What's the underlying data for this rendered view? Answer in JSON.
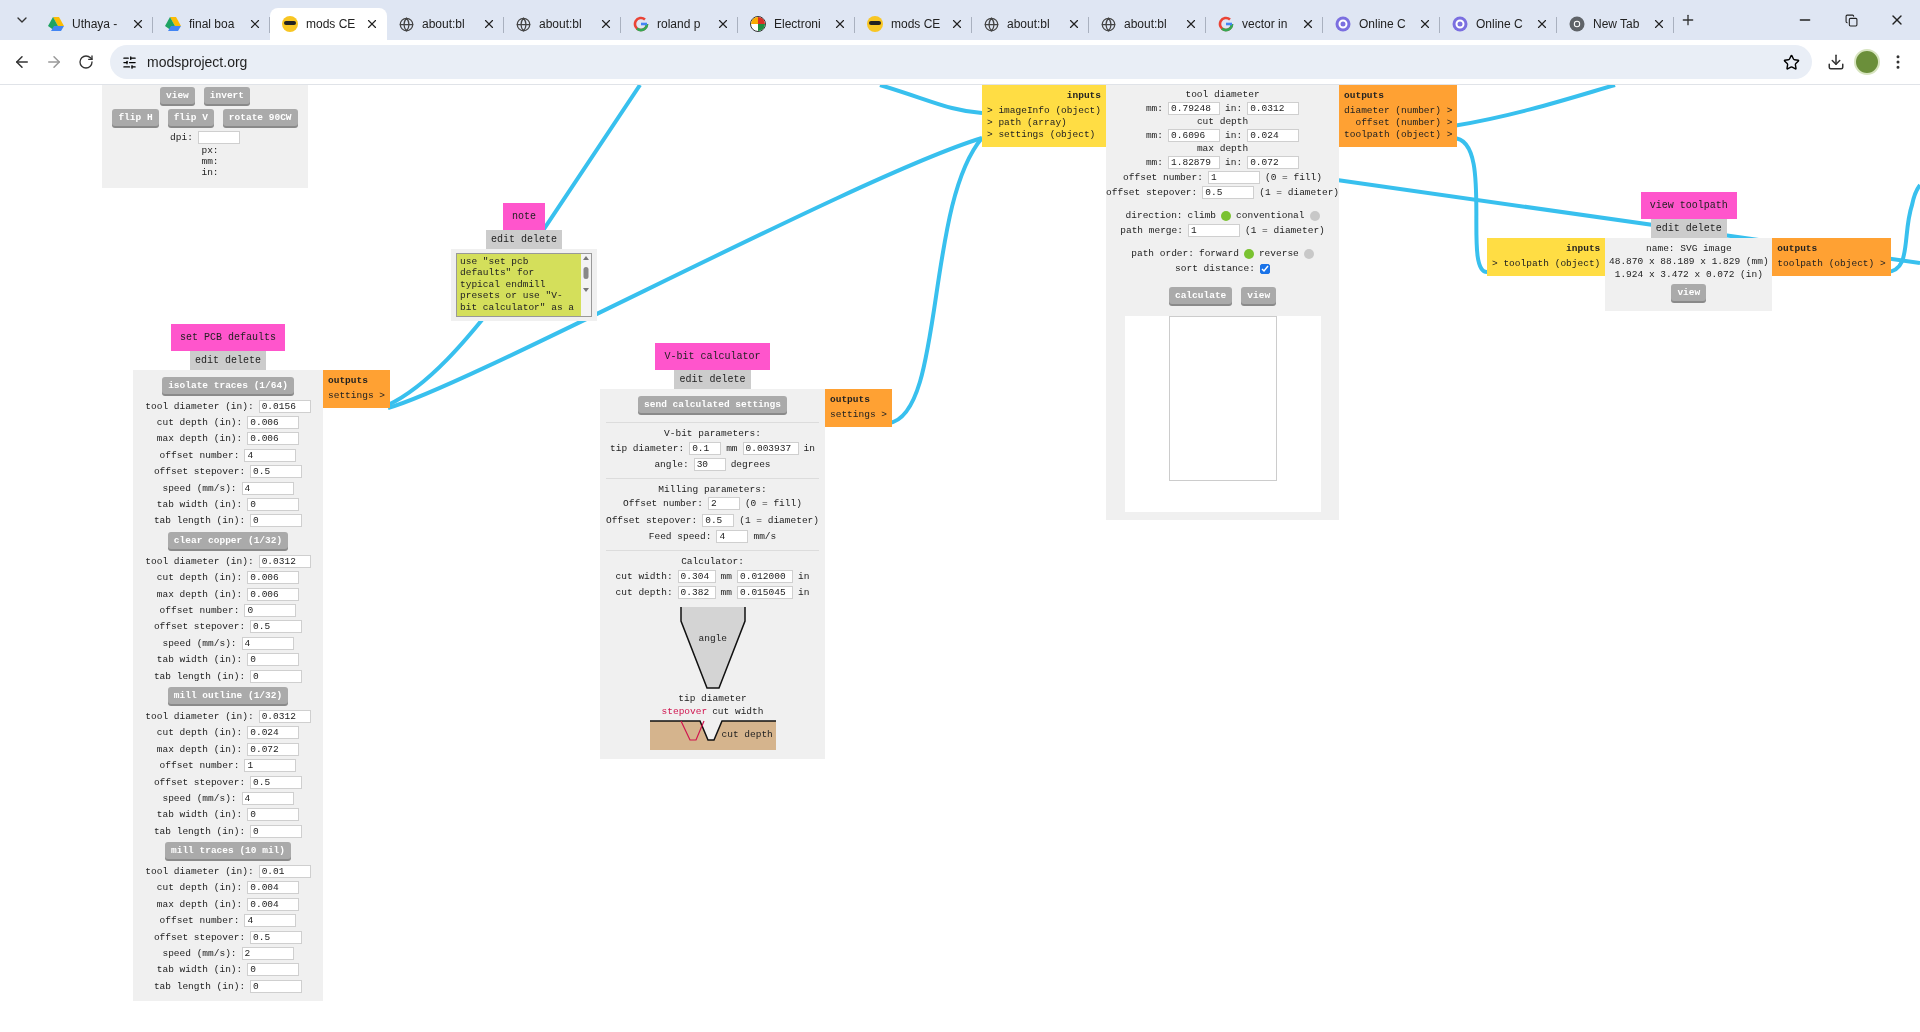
{
  "browser": {
    "tabs": [
      {
        "title": "Uthaya -",
        "kind": "drive",
        "selected": false
      },
      {
        "title": "final boa",
        "kind": "drive",
        "selected": false
      },
      {
        "title": "mods CE",
        "kind": "emoji",
        "selected": true
      },
      {
        "title": "about:bl",
        "kind": "globe",
        "selected": false
      },
      {
        "title": "about:bl",
        "kind": "globe",
        "selected": false
      },
      {
        "title": "roland p",
        "kind": "google",
        "selected": false
      },
      {
        "title": "Electroni",
        "kind": "pinwheel",
        "selected": false
      },
      {
        "title": "mods CE",
        "kind": "emoji",
        "selected": false
      },
      {
        "title": "about:bl",
        "kind": "globe",
        "selected": false
      },
      {
        "title": "about:bl",
        "kind": "globe",
        "selected": false
      },
      {
        "title": "vector in",
        "kind": "google",
        "selected": false
      },
      {
        "title": "Online C",
        "kind": "swirl",
        "selected": false
      },
      {
        "title": "Online C",
        "kind": "swirl",
        "selected": false
      },
      {
        "title": "New Tab",
        "kind": "chrome",
        "selected": false
      }
    ],
    "url": "modsproject.org"
  },
  "image_module": {
    "button_rows": [
      [
        "view",
        "invert"
      ],
      [
        "flip H",
        "flip V",
        "rotate 90CW"
      ]
    ],
    "dpi_label": "dpi:",
    "readouts": [
      "px:",
      "mm:",
      "in:"
    ]
  },
  "pcb_defaults": {
    "title": "set PCB defaults",
    "actions": [
      "edit",
      "delete"
    ],
    "outputs": {
      "heading": "outputs",
      "ports": [
        "settings >"
      ]
    },
    "sections": [
      {
        "button": "isolate traces (1/64)",
        "fields": [
          {
            "label": "tool diameter (in):",
            "value": "0.0156"
          },
          {
            "label": "cut depth (in):",
            "value": "0.006"
          },
          {
            "label": "max depth (in):",
            "value": "0.006"
          },
          {
            "label": "offset number:",
            "value": "4"
          },
          {
            "label": "offset stepover:",
            "value": "0.5"
          },
          {
            "label": "speed (mm/s):",
            "value": "4"
          },
          {
            "label": "tab width (in):",
            "value": "0"
          },
          {
            "label": "tab length (in):",
            "value": "0"
          }
        ]
      },
      {
        "button": "clear copper (1/32)",
        "fields": [
          {
            "label": "tool diameter (in):",
            "value": "0.0312"
          },
          {
            "label": "cut depth (in):",
            "value": "0.006"
          },
          {
            "label": "max depth (in):",
            "value": "0.006"
          },
          {
            "label": "offset number:",
            "value": "0"
          },
          {
            "label": "offset stepover:",
            "value": "0.5"
          },
          {
            "label": "speed (mm/s):",
            "value": "4"
          },
          {
            "label": "tab width (in):",
            "value": "0"
          },
          {
            "label": "tab length (in):",
            "value": "0"
          }
        ]
      },
      {
        "button": "mill outline (1/32)",
        "fields": [
          {
            "label": "tool diameter (in):",
            "value": "0.0312"
          },
          {
            "label": "cut depth (in):",
            "value": "0.024"
          },
          {
            "label": "max depth (in):",
            "value": "0.072"
          },
          {
            "label": "offset number:",
            "value": "1"
          },
          {
            "label": "offset stepover:",
            "value": "0.5"
          },
          {
            "label": "speed (mm/s):",
            "value": "4"
          },
          {
            "label": "tab width (in):",
            "value": "0"
          },
          {
            "label": "tab length (in):",
            "value": "0"
          }
        ]
      },
      {
        "button": "mill traces (10 mil)",
        "fields": [
          {
            "label": "tool diameter (in):",
            "value": "0.01"
          },
          {
            "label": "cut depth (in):",
            "value": "0.004"
          },
          {
            "label": "max depth (in):",
            "value": "0.004"
          },
          {
            "label": "offset number:",
            "value": "4"
          },
          {
            "label": "offset stepover:",
            "value": "0.5"
          },
          {
            "label": "speed (mm/s):",
            "value": "2"
          },
          {
            "label": "tab width (in):",
            "value": "0"
          },
          {
            "label": "tab length (in):",
            "value": "0"
          }
        ]
      }
    ]
  },
  "note": {
    "title": "note",
    "actions": [
      "edit",
      "delete"
    ],
    "text": "use \"set pcb defaults\" for typical endmill presets or use \"V-bit calculator\" as a"
  },
  "vbit": {
    "title": "V-bit calculator",
    "actions": [
      "edit",
      "delete"
    ],
    "outputs": {
      "heading": "outputs",
      "ports": [
        "settings >"
      ]
    },
    "send_button": "send calculated settings",
    "groups": [
      {
        "heading": "V-bit parameters:",
        "rows": [
          {
            "label": "tip diameter:",
            "parts": [
              {
                "kind": "field",
                "text": "0.1"
              },
              {
                "kind": "text",
                "text": "mm"
              },
              {
                "kind": "field",
                "text": "0.003937"
              },
              {
                "kind": "text",
                "text": "in"
              }
            ]
          },
          {
            "label": "angle:",
            "parts": [
              {
                "kind": "field",
                "text": "30"
              },
              {
                "kind": "text",
                "text": "degrees"
              }
            ]
          }
        ]
      },
      {
        "heading": "Milling parameters:",
        "rows": [
          {
            "label": "Offset number:",
            "parts": [
              {
                "kind": "field",
                "text": "2"
              },
              {
                "kind": "text",
                "text": "(0 = fill)"
              }
            ]
          },
          {
            "label": "Offset stepover:",
            "parts": [
              {
                "kind": "field",
                "text": "0.5"
              },
              {
                "kind": "text",
                "text": "(1 = diameter)"
              }
            ]
          },
          {
            "label": "Feed speed:",
            "parts": [
              {
                "kind": "field",
                "text": "4"
              },
              {
                "kind": "text",
                "text": "mm/s"
              }
            ]
          }
        ]
      },
      {
        "heading": "Calculator:",
        "rows": [
          {
            "label": "cut width:",
            "parts": [
              {
                "kind": "field",
                "text": "0.304"
              },
              {
                "kind": "text",
                "text": "mm"
              },
              {
                "kind": "field",
                "text": "0.012000"
              },
              {
                "kind": "text",
                "text": "in"
              }
            ]
          },
          {
            "label": "cut depth:",
            "parts": [
              {
                "kind": "field",
                "text": "0.382"
              },
              {
                "kind": "text",
                "text": "mm"
              },
              {
                "kind": "field",
                "text": "0.015045"
              },
              {
                "kind": "text",
                "text": "in"
              }
            ]
          }
        ]
      }
    ],
    "diagram": {
      "angle": "angle",
      "tip_diameter": "tip diameter",
      "stepover": "stepover",
      "cut_width": "cut width",
      "cut_depth": "cut depth"
    }
  },
  "mill_raster": {
    "inputs": {
      "heading": "inputs",
      "ports": [
        "> imageInfo (object)",
        "> path (array)",
        "> settings (object)"
      ]
    },
    "outputs": {
      "heading": "outputs",
      "ports": [
        "diameter (number) >",
        "offset (number) >",
        "toolpath (object) >"
      ]
    },
    "groups": [
      [
        {
          "kind": "heading",
          "text": "tool diameter"
        },
        {
          "kind": "row",
          "label": "mm:",
          "parts": [
            {
              "kind": "field",
              "text": "0.79248"
            },
            {
              "kind": "text",
              "text": "in:"
            },
            {
              "kind": "field",
              "text": "0.0312"
            }
          ]
        },
        {
          "kind": "heading",
          "text": "cut depth"
        },
        {
          "kind": "row",
          "label": "mm:",
          "parts": [
            {
              "kind": "field",
              "text": "0.6096"
            },
            {
              "kind": "text",
              "text": "in:"
            },
            {
              "kind": "field",
              "text": "0.024"
            }
          ]
        },
        {
          "kind": "heading",
          "text": "max depth"
        },
        {
          "kind": "row",
          "label": "mm:",
          "parts": [
            {
              "kind": "field",
              "text": "1.82879"
            },
            {
              "kind": "text",
              "text": "in:"
            },
            {
              "kind": "field",
              "text": "0.072"
            }
          ]
        },
        {
          "kind": "row",
          "label": "offset number:",
          "parts": [
            {
              "kind": "field",
              "text": "1"
            },
            {
              "kind": "text",
              "text": "(0 = fill)"
            }
          ]
        },
        {
          "kind": "row",
          "label": "offset stepover:",
          "parts": [
            {
              "kind": "field",
              "text": "0.5"
            },
            {
              "kind": "text",
              "text": "(1 = diameter)"
            }
          ]
        }
      ],
      [
        {
          "kind": "row",
          "label": "direction:",
          "parts": [
            {
              "kind": "radio",
              "text": "climb",
              "selected": true
            },
            {
              "kind": "radio",
              "text": "conventional",
              "selected": false
            }
          ]
        },
        {
          "kind": "row",
          "label": "path merge:",
          "parts": [
            {
              "kind": "field",
              "text": "1"
            },
            {
              "kind": "text",
              "text": "(1 = diameter)"
            }
          ]
        }
      ],
      [
        {
          "kind": "row",
          "label": "path order:",
          "parts": [
            {
              "kind": "radio",
              "text": "forward",
              "selected": true
            },
            {
              "kind": "radio",
              "text": "reverse",
              "selected": false
            }
          ]
        },
        {
          "kind": "row",
          "label": "sort distance:",
          "parts": [
            {
              "kind": "checkbox",
              "checked": true
            }
          ]
        }
      ]
    ],
    "buttons": [
      "calculate",
      "view"
    ]
  },
  "view_toolpath": {
    "title": "view toolpath",
    "actions": [
      "edit",
      "delete"
    ],
    "inputs": {
      "heading": "inputs",
      "ports": [
        "> toolpath (object)"
      ]
    },
    "outputs": {
      "heading": "outputs",
      "ports": [
        "toolpath (object) >"
      ]
    },
    "lines": [
      "name: SVG image",
      "48.870 x 88.189 x 1.829 (mm)",
      "1.924 x 3.472 x 0.072 (in)"
    ],
    "button": "view"
  }
}
